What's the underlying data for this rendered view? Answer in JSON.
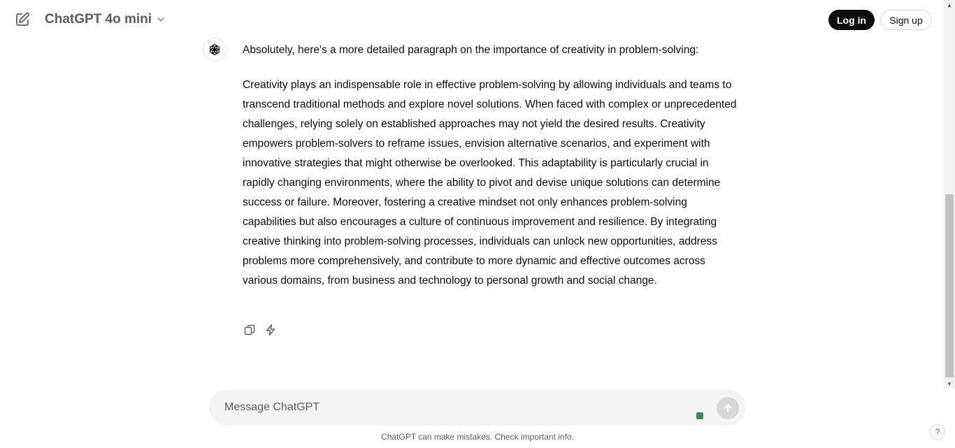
{
  "header": {
    "model_name": "ChatGPT 4o mini",
    "login_label": "Log in",
    "signup_label": "Sign up"
  },
  "message": {
    "intro": "Absolutely, here's a more detailed paragraph on the importance of creativity in problem-solving:",
    "body": "Creativity plays an indispensable role in effective problem-solving by allowing individuals and teams to transcend traditional methods and explore novel solutions. When faced with complex or unprecedented challenges, relying solely on established approaches may not yield the desired results. Creativity empowers problem-solvers to reframe issues, envision alternative scenarios, and experiment with innovative strategies that might otherwise be overlooked. This adaptability is particularly crucial in rapidly changing environments, where the ability to pivot and devise unique solutions can determine success or failure. Moreover, fostering a creative mindset not only enhances problem-solving capabilities but also encourages a culture of continuous improvement and resilience. By integrating creative thinking into problem-solving processes, individuals can unlock new opportunities, address problems more comprehensively, and contribute to more dynamic and effective outcomes across various domains, from business and technology to personal growth and social change."
  },
  "composer": {
    "placeholder": "Message ChatGPT"
  },
  "footer": {
    "disclaimer": "ChatGPT can make mistakes. Check important info.",
    "help_label": "?"
  },
  "icons": {
    "new_chat": "edit-icon",
    "model_dropdown": "chevron-down-icon",
    "avatar": "openai-logo-icon",
    "copy": "copy-icon",
    "regenerate": "lightning-icon",
    "send": "arrow-up-icon"
  },
  "colors": {
    "primary_button": "#0d0d0d",
    "composer_bg": "#f4f4f4",
    "status_dot": "#3d8b53"
  }
}
